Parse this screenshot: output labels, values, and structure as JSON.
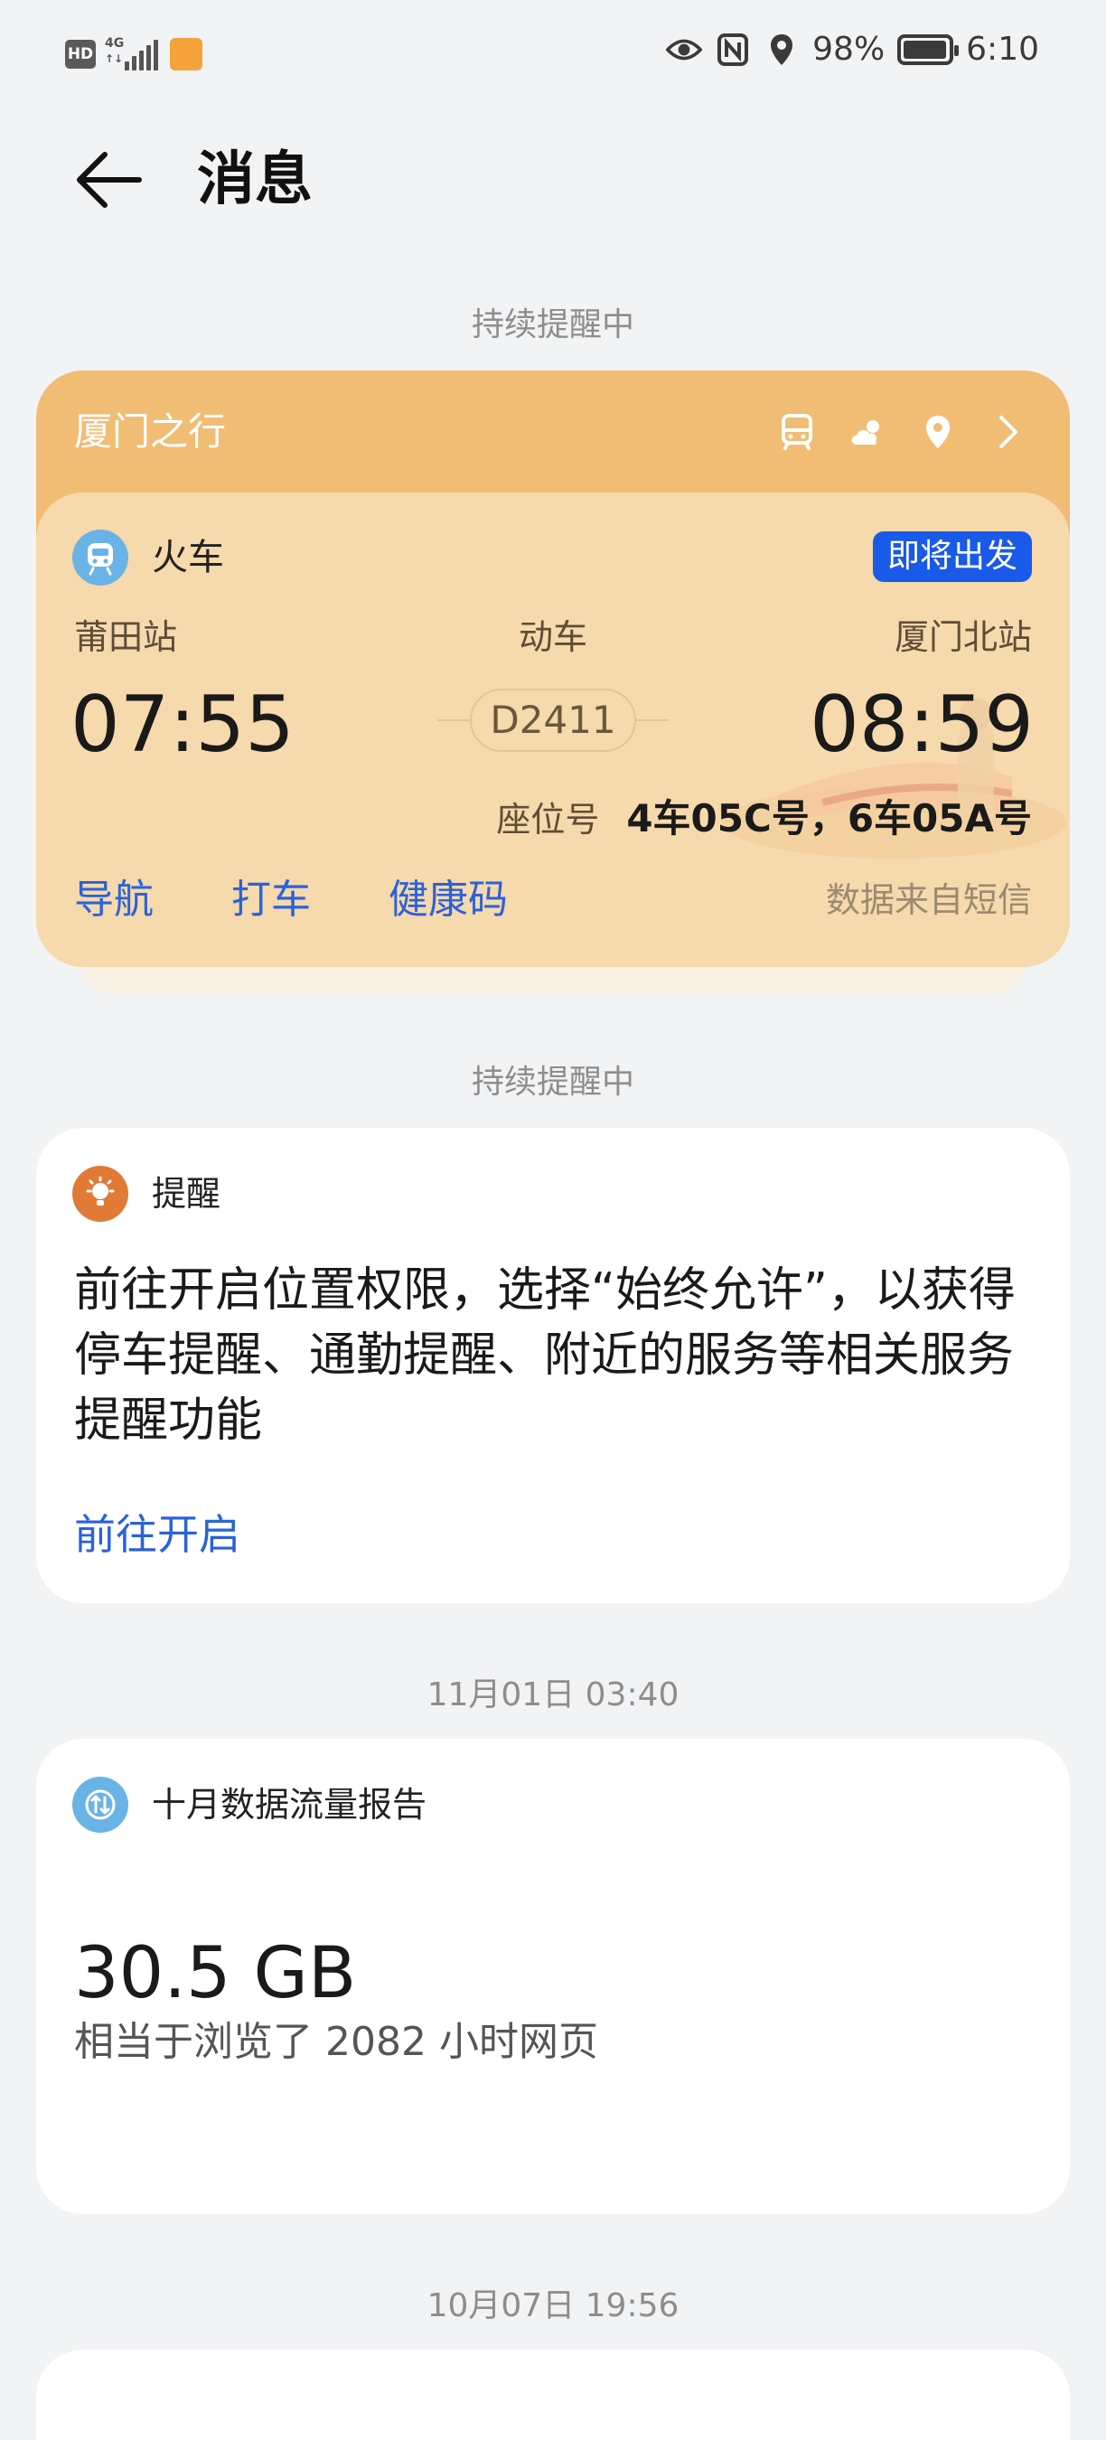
{
  "status_bar": {
    "hd": "HD",
    "network": "4G",
    "app_icon_label": "",
    "battery_percent": "98%",
    "battery_level": 0.98,
    "time": "6:10"
  },
  "header": {
    "title": "消息"
  },
  "sections": {
    "ongoing_1": "持续提醒中",
    "ongoing_2": "持续提醒中",
    "date_1": "11月01日 03:40",
    "date_2": "10月07日 19:56"
  },
  "trip": {
    "title": "厦门之行",
    "type_label": "火车",
    "status": "即将出发",
    "from_station": "莆田站",
    "train_type": "动车",
    "to_station": "厦门北站",
    "depart_time": "07:55",
    "train_number": "D2411",
    "arrive_time": "08:59",
    "seat_label": "座位号",
    "seat_value": "4车05C号，6车05A号",
    "actions": {
      "navigate": "导航",
      "taxi": "打车",
      "health_code": "健康码"
    },
    "source": "数据来自短信"
  },
  "reminder": {
    "title": "提醒",
    "body": "前往开启位置权限，选择“始终允许”，以获得停车提醒、通勤提醒、附近的服务等相关服务提醒功能",
    "link": "前往开启"
  },
  "data_report": {
    "title": "十月数据流量报告",
    "amount": "30.5 GB",
    "description": "相当于浏览了 2082 小时网页"
  },
  "colors": {
    "background": "#f1f3f5",
    "trip_header": "#f1bd74",
    "ticket": "#f6d9ac",
    "accent_blue": "#2a62d9",
    "badge_blue": "#1a5ae8",
    "reminder_icon": "#e07a35",
    "data_icon": "#69b3e6"
  },
  "icons": [
    "back-arrow-icon",
    "bus-icon",
    "weather-icon",
    "location-pin-icon",
    "chevron-right-icon",
    "train-icon",
    "lightbulb-icon",
    "data-transfer-icon",
    "eye-icon",
    "nfc-icon"
  ]
}
